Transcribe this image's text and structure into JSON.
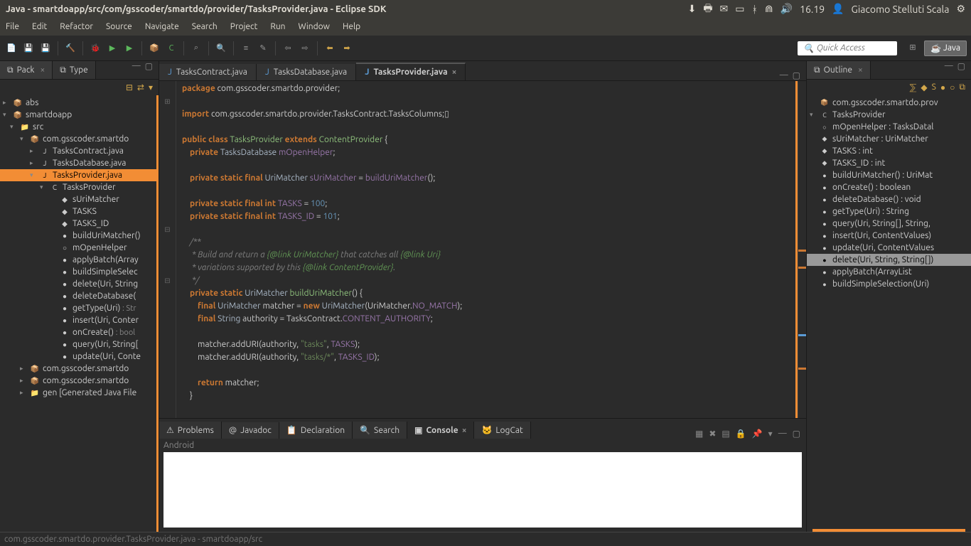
{
  "topbar": {
    "title": "Java - smartdoapp/src/com/gsscoder/smartdo/provider/TasksProvider.java - Eclipse SDK",
    "time": "16.19",
    "user": "Giacomo Stelluti Scala"
  },
  "menu": [
    "File",
    "Edit",
    "Refactor",
    "Source",
    "Navigate",
    "Search",
    "Project",
    "Run",
    "Window",
    "Help"
  ],
  "quick_access": "Quick Access",
  "perspective": "Java",
  "left": {
    "tabs": [
      {
        "label": "Pack",
        "active": true
      },
      {
        "label": "Type",
        "active": false
      }
    ]
  },
  "package_tree": [
    {
      "ind": 0,
      "arrow": "▸",
      "icon": "📦",
      "label": "abs"
    },
    {
      "ind": 0,
      "arrow": "▾",
      "icon": "📦",
      "label": "smartdoapp"
    },
    {
      "ind": 1,
      "arrow": "▾",
      "icon": "📁",
      "label": "src"
    },
    {
      "ind": 2,
      "arrow": "▾",
      "icon": "📦",
      "label": "com.gsscoder.smartdo"
    },
    {
      "ind": 3,
      "arrow": "▸",
      "icon": "J",
      "label": "TasksContract.java"
    },
    {
      "ind": 3,
      "arrow": "▸",
      "icon": "J",
      "label": "TasksDatabase.java"
    },
    {
      "ind": 3,
      "arrow": "▾",
      "icon": "J",
      "label": "TasksProvider.java",
      "selected": true
    },
    {
      "ind": 4,
      "arrow": "▾",
      "icon": "C",
      "label": "TasksProvider"
    },
    {
      "ind": 5,
      "arrow": "",
      "icon": "◆",
      "label": "sUriMatcher"
    },
    {
      "ind": 5,
      "arrow": "",
      "icon": "◆",
      "label": "TASKS"
    },
    {
      "ind": 5,
      "arrow": "",
      "icon": "◆",
      "label": "TASKS_ID"
    },
    {
      "ind": 5,
      "arrow": "",
      "icon": "●",
      "label": "buildUriMatcher()"
    },
    {
      "ind": 5,
      "arrow": "",
      "icon": "○",
      "label": "mOpenHelper"
    },
    {
      "ind": 5,
      "arrow": "",
      "icon": "●",
      "label": "applyBatch(Array"
    },
    {
      "ind": 5,
      "arrow": "",
      "icon": "●",
      "label": "buildSimpleSelec"
    },
    {
      "ind": 5,
      "arrow": "",
      "icon": "●",
      "label": "delete(Uri, String"
    },
    {
      "ind": 5,
      "arrow": "",
      "icon": "●",
      "label": "deleteDatabase("
    },
    {
      "ind": 5,
      "arrow": "",
      "icon": "●",
      "label": "getType(Uri)",
      "ret": ": Str"
    },
    {
      "ind": 5,
      "arrow": "",
      "icon": "●",
      "label": "insert(Uri, Conter"
    },
    {
      "ind": 5,
      "arrow": "",
      "icon": "●",
      "label": "onCreate()",
      "ret": ": bool"
    },
    {
      "ind": 5,
      "arrow": "",
      "icon": "●",
      "label": "query(Uri, String["
    },
    {
      "ind": 5,
      "arrow": "",
      "icon": "●",
      "label": "update(Uri, Conte"
    },
    {
      "ind": 2,
      "arrow": "▸",
      "icon": "📦",
      "label": "com.gsscoder.smartdo"
    },
    {
      "ind": 2,
      "arrow": "▸",
      "icon": "📦",
      "label": "com.gsscoder.smartdo"
    },
    {
      "ind": 2,
      "arrow": "▸",
      "icon": "📁",
      "label": "gen [Generated Java File"
    }
  ],
  "editor": {
    "tabs": [
      {
        "label": "TasksContract.java",
        "active": false
      },
      {
        "label": "TasksDatabase.java",
        "active": false
      },
      {
        "label": "TasksProvider.java",
        "active": true
      }
    ]
  },
  "bottom": {
    "tabs": [
      {
        "icon": "⚠",
        "label": "Problems"
      },
      {
        "icon": "@",
        "label": "Javadoc"
      },
      {
        "icon": "📋",
        "label": "Declaration"
      },
      {
        "icon": "🔍",
        "label": "Search"
      },
      {
        "icon": "▣",
        "label": "Console",
        "active": true
      },
      {
        "icon": "🐱",
        "label": "LogCat"
      }
    ],
    "console_title": "Android"
  },
  "outline": {
    "tab": "Outline",
    "items": [
      {
        "ind": 1,
        "icon": "📦",
        "label": "com.gsscoder.smartdo.prov"
      },
      {
        "ind": 0,
        "arrow": "▾",
        "icon": "C",
        "label": "TasksProvider"
      },
      {
        "ind": 1,
        "icon": "○",
        "label": "mOpenHelper",
        "ret": ": TasksDatal"
      },
      {
        "ind": 1,
        "icon": "◆",
        "label": "sUriMatcher",
        "ret": ": UriMatcher"
      },
      {
        "ind": 1,
        "icon": "◆",
        "label": "TASKS",
        "ret": ": int"
      },
      {
        "ind": 1,
        "icon": "◆",
        "label": "TASKS_ID",
        "ret": ": int"
      },
      {
        "ind": 1,
        "icon": "●",
        "label": "buildUriMatcher()",
        "ret": ": UriMat"
      },
      {
        "ind": 1,
        "icon": "●",
        "label": "onCreate()",
        "ret": ": boolean"
      },
      {
        "ind": 1,
        "icon": "●",
        "label": "deleteDatabase()",
        "ret": ": void"
      },
      {
        "ind": 1,
        "icon": "●",
        "label": "getType(Uri)",
        "ret": ": String"
      },
      {
        "ind": 1,
        "icon": "●",
        "label": "query(Uri, String[], String,"
      },
      {
        "ind": 1,
        "icon": "●",
        "label": "insert(Uri, ContentValues)"
      },
      {
        "ind": 1,
        "icon": "●",
        "label": "update(Uri, ContentValues"
      },
      {
        "ind": 1,
        "icon": "●",
        "label": "delete(Uri, String, String[])",
        "highlighted": true
      },
      {
        "ind": 1,
        "icon": "●",
        "label": "applyBatch(ArrayList<Con"
      },
      {
        "ind": 1,
        "icon": "●",
        "label": "buildSimpleSelection(Uri)"
      }
    ]
  },
  "status": "com.gsscoder.smartdo.provider.TasksProvider.java - smartdoapp/src"
}
